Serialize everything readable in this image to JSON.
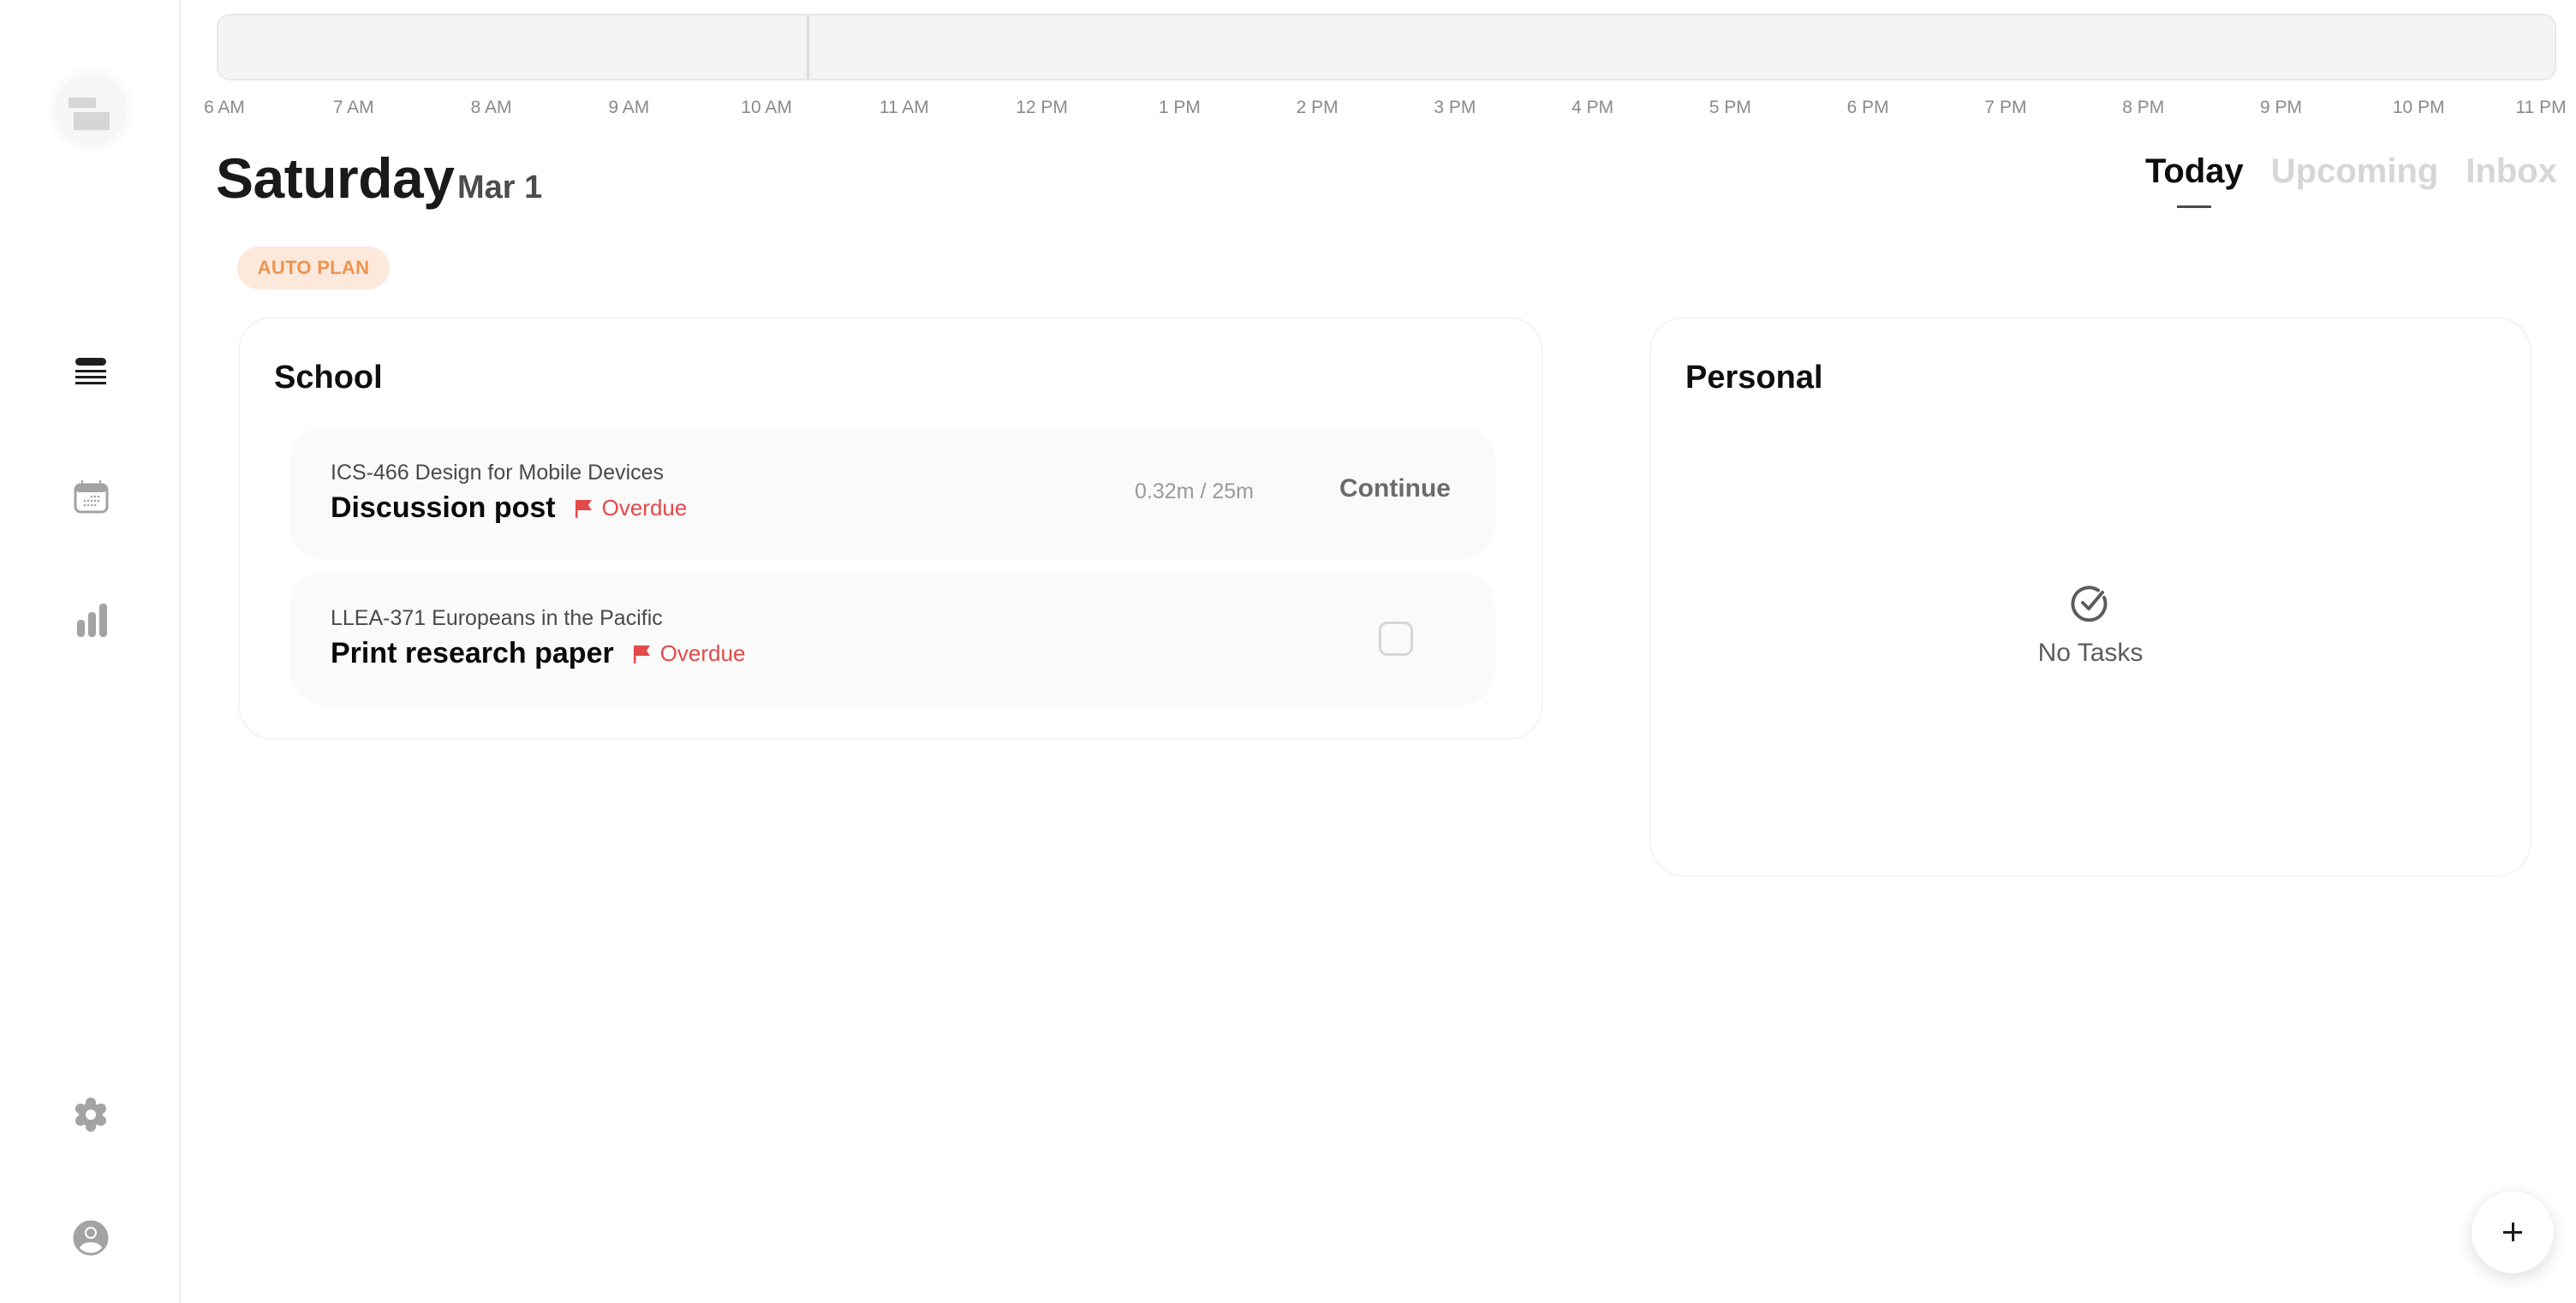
{
  "sidebar": {
    "items": [
      {
        "name": "tasks",
        "icon": "list-icon",
        "active": true
      },
      {
        "name": "calendar",
        "icon": "calendar-icon",
        "active": false
      },
      {
        "name": "stats",
        "icon": "bar-chart-icon",
        "active": false
      }
    ],
    "bottom_items": [
      {
        "name": "settings",
        "icon": "gear-icon"
      },
      {
        "name": "profile",
        "icon": "user-avatar-icon"
      }
    ]
  },
  "timeline": {
    "hours": [
      "6 AM",
      "7 AM",
      "8 AM",
      "9 AM",
      "10 AM",
      "11 AM",
      "12 PM",
      "1 PM",
      "2 PM",
      "3 PM",
      "4 PM",
      "5 PM",
      "6 PM",
      "7 PM",
      "8 PM",
      "9 PM",
      "10 PM",
      "11 PM"
    ],
    "current_time_hours": 10.28
  },
  "header": {
    "day": "Saturday",
    "date": "Mar 1",
    "tabs": [
      {
        "label": "Today",
        "active": true
      },
      {
        "label": "Upcoming",
        "active": false
      },
      {
        "label": "Inbox",
        "active": false
      }
    ],
    "auto_plan_label": "AUTO PLAN"
  },
  "groups": {
    "school": {
      "title": "School",
      "tasks": [
        {
          "course": "ICS-466 Design for Mobile Devices",
          "name": "Discussion post",
          "status": "Overdue",
          "time_readout": "0.32m / 25m",
          "action_label": "Continue"
        },
        {
          "course": "LLEA-371 Europeans in the Pacific",
          "name": "Print research paper",
          "status": "Overdue",
          "completed": false
        }
      ]
    },
    "personal": {
      "title": "Personal",
      "empty_label": "No Tasks"
    }
  },
  "colors": {
    "accent_orange": "#ef9350",
    "auto_plan_bg": "#fde9dc",
    "overdue_red": "#e34a4a",
    "inactive_tab": "#d6d6d6"
  },
  "fab": {
    "icon": "plus-icon"
  }
}
